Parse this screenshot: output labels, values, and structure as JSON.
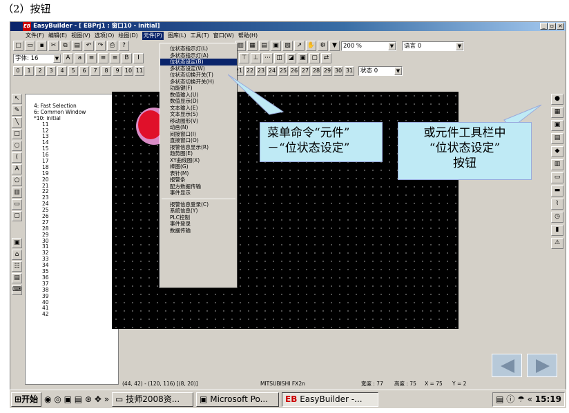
{
  "heading": "（2）按钮",
  "window": {
    "title": "EasyBuilder - [ EBPrj1 : 窗口10 - initial]",
    "logo": "EB"
  },
  "menubar": [
    "文件(F)",
    "编辑(E)",
    "视图(V)",
    "选项(O)",
    "绘图(D)",
    "元件(P)",
    "图库(L)",
    "工具(T)",
    "窗口(W)",
    "帮助(H)"
  ],
  "toolbar": {
    "zoom": "200 %",
    "language": "语言 0",
    "font": "字体: 16",
    "state": "状态 0"
  },
  "numtabs": [
    "0",
    "1",
    "2",
    "3",
    "4",
    "5",
    "6",
    "7",
    "8",
    "9",
    "10",
    "11",
    "18",
    "19",
    "20",
    "21",
    "22",
    "23",
    "24",
    "25",
    "26",
    "27",
    "28",
    "29",
    "30",
    "31"
  ],
  "tree": [
    "4: Fast Selection",
    "6: Common Window",
    "*10: initial",
    "11",
    "12",
    "13",
    "14",
    "15",
    "16",
    "17",
    "18",
    "19",
    "20",
    "21",
    "22",
    "23",
    "24",
    "25",
    "26",
    "27",
    "28",
    "29",
    "30",
    "31",
    "32",
    "33",
    "34",
    "35",
    "36",
    "37",
    "38",
    "39",
    "40",
    "41",
    "42"
  ],
  "menu": {
    "items": [
      "位状态指示灯(L)",
      "多状态指示灯(A)",
      "位状态设定(B)",
      "多状态设定(W)",
      "位状态切换开关(T)",
      "多状态切换开关(H)",
      "功能键(F)",
      "数值输入(U)",
      "数值显示(D)",
      "文本输入(E)",
      "文本显示(S)",
      "移动图形(V)",
      "动画(N)",
      "间接窗口(I)",
      "直接窗口(O)",
      "报警信息显示(R)",
      "趋势图(E)",
      "XY曲线图(X)",
      "棒图(G)",
      "表针(M)",
      "报警条",
      "配方数据传输",
      "事件显示"
    ],
    "items2": [
      "报警信息登录(C)",
      "系统信息(Y)",
      "PLC控制",
      "事件登录",
      "数据传输"
    ],
    "highlight": 2
  },
  "callouts": {
    "left": "菜单命令“元件”\n－“位状态设定”",
    "right": "或元件工具栏中\n“位状态设定”\n按钮"
  },
  "status": {
    "coords": "(44, 42) - (120, 116) [(8, 20)]",
    "plc": "MITSUBISHI FX2n",
    "width": "宽度 : 77",
    "height": "高度 : 75",
    "x": "X = 75",
    "y": "Y = 2"
  },
  "taskbar": {
    "start": "开始",
    "items": [
      "技师2008资...",
      "Microsoft Po...",
      "EasyBuilder -..."
    ],
    "clock": "15:19"
  }
}
